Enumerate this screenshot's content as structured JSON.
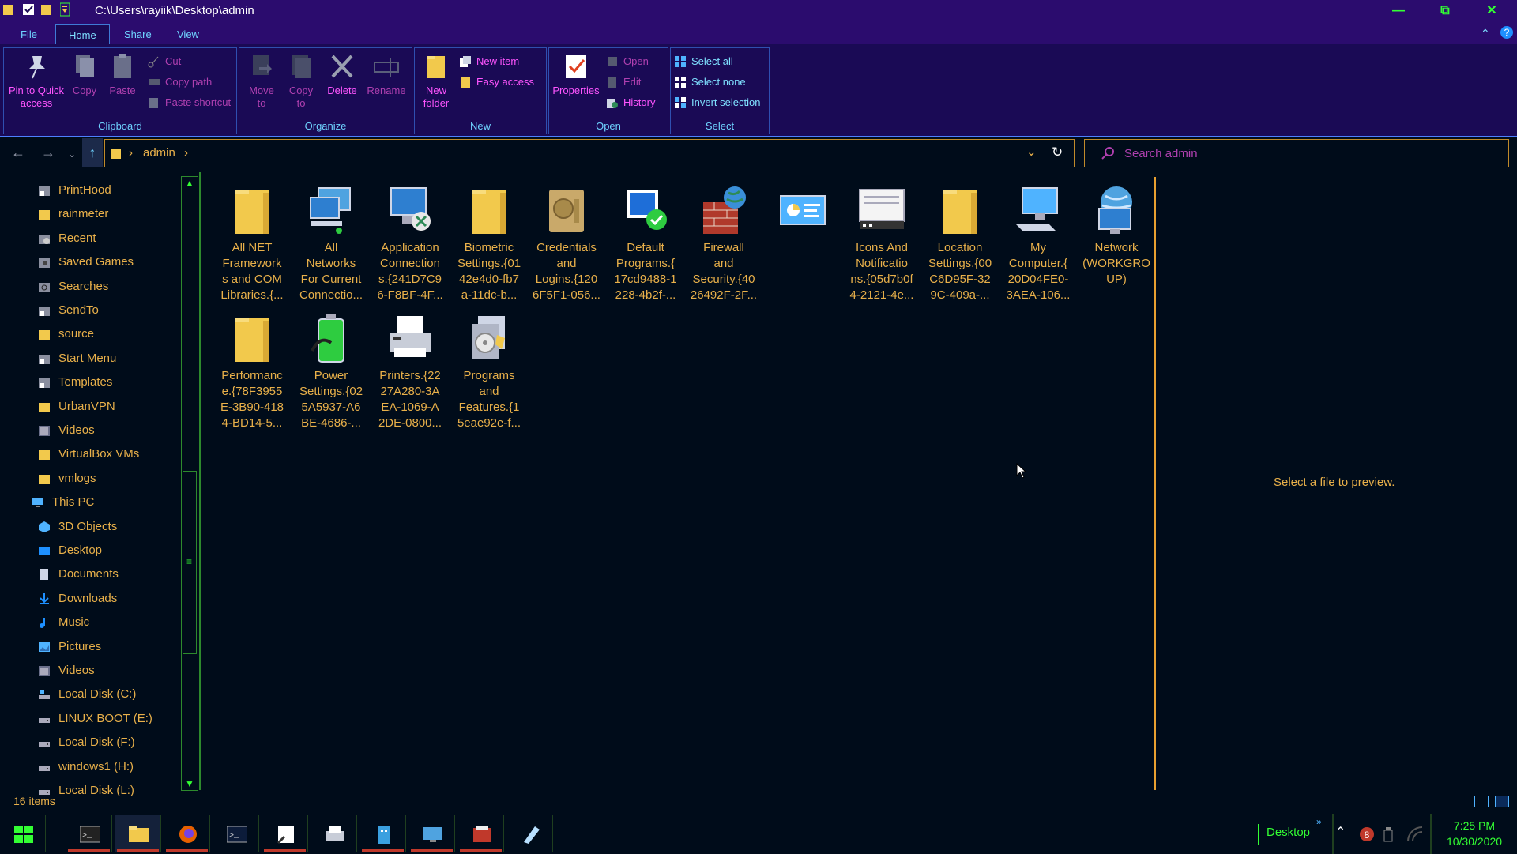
{
  "window": {
    "title": "C:\\Users\\rayiik\\Desktop\\admin",
    "minimize_glyph": "—",
    "maximize_glyph": "⧉",
    "close_glyph": "✕"
  },
  "ribbon_tabs": [
    "File",
    "Home",
    "Share",
    "View"
  ],
  "ribbon": {
    "clipboard": {
      "label": "Clipboard",
      "pin": "Pin to Quick access",
      "copy": "Copy",
      "paste": "Paste",
      "cut": "Cut",
      "copy_path": "Copy path",
      "paste_shortcut": "Paste shortcut"
    },
    "organize": {
      "label": "Organize",
      "move_to": "Move to",
      "copy_to": "Copy to",
      "delete": "Delete",
      "rename": "Rename"
    },
    "new": {
      "label": "New",
      "new_folder": "New folder",
      "new_item": "New item",
      "easy_access": "Easy access"
    },
    "open": {
      "label": "Open",
      "properties": "Properties",
      "open": "Open",
      "edit": "Edit",
      "history": "History"
    },
    "select": {
      "label": "Select",
      "select_all": "Select all",
      "select_none": "Select none",
      "invert_selection": "Invert selection"
    }
  },
  "address": {
    "crumbs": [
      "admin"
    ],
    "search_placeholder": "Search admin"
  },
  "nav_items": [
    {
      "label": "PrintHood",
      "icon": "shortcut-folder-icon"
    },
    {
      "label": "rainmeter",
      "icon": "folder-icon"
    },
    {
      "label": "Recent",
      "icon": "recent-icon"
    },
    {
      "label": "Saved Games",
      "icon": "saved-games-icon"
    },
    {
      "label": "Searches",
      "icon": "searches-icon"
    },
    {
      "label": "SendTo",
      "icon": "shortcut-folder-icon"
    },
    {
      "label": "source",
      "icon": "folder-icon"
    },
    {
      "label": "Start Menu",
      "icon": "shortcut-folder-icon"
    },
    {
      "label": "Templates",
      "icon": "shortcut-folder-icon"
    },
    {
      "label": "UrbanVPN",
      "icon": "folder-icon"
    },
    {
      "label": "Videos",
      "icon": "videos-icon"
    },
    {
      "label": "VirtualBox VMs",
      "icon": "folder-icon"
    },
    {
      "label": "vmlogs",
      "icon": "folder-icon"
    },
    {
      "label": "This PC",
      "icon": "this-pc-icon"
    },
    {
      "label": "3D Objects",
      "icon": "3d-objects-icon"
    },
    {
      "label": "Desktop",
      "icon": "desktop-icon"
    },
    {
      "label": "Documents",
      "icon": "documents-icon"
    },
    {
      "label": "Downloads",
      "icon": "downloads-icon"
    },
    {
      "label": "Music",
      "icon": "music-icon"
    },
    {
      "label": "Pictures",
      "icon": "pictures-icon"
    },
    {
      "label": "Videos",
      "icon": "videos-icon"
    },
    {
      "label": "Local Disk (C:)",
      "icon": "system-drive-icon"
    },
    {
      "label": "LINUX BOOT (E:)",
      "icon": "drive-icon"
    },
    {
      "label": "Local Disk (F:)",
      "icon": "drive-icon"
    },
    {
      "label": "windows1 (H:)",
      "icon": "drive-icon"
    },
    {
      "label": "Local Disk (L:)",
      "icon": "drive-icon"
    }
  ],
  "files": [
    {
      "lines": [
        "All NET",
        "Framework",
        "s and COM",
        "Libraries.{..."
      ],
      "icon": "folder-icon"
    },
    {
      "lines": [
        "All",
        "Networks",
        "For Current",
        "Connectio..."
      ],
      "icon": "network-computers-icon"
    },
    {
      "lines": [
        "Application",
        "Connection",
        "s.{241D7C9",
        "6-F8BF-4F..."
      ],
      "icon": "remote-app-icon"
    },
    {
      "lines": [
        "Biometric",
        "Settings.{01",
        "42e4d0-fb7",
        "a-11dc-b..."
      ],
      "icon": "folder-icon"
    },
    {
      "lines": [
        "Credentials",
        "and",
        "Logins.{120",
        "6F5F1-056..."
      ],
      "icon": "credentials-vault-icon"
    },
    {
      "lines": [
        "Default",
        "Programs.{",
        "17cd9488-1",
        "228-4b2f-..."
      ],
      "icon": "default-programs-icon"
    },
    {
      "lines": [
        "Firewall",
        "and",
        "Security.{40",
        "26492F-2F..."
      ],
      "icon": "firewall-icon"
    },
    {
      "lines": [],
      "icon": "control-panel-icon"
    },
    {
      "lines": [
        "Icons And",
        "Notificatio",
        "ns.{05d7b0f",
        "4-2121-4e..."
      ],
      "icon": "notifications-icon"
    },
    {
      "lines": [
        "Location",
        "Settings.{00",
        "C6D95F-32",
        "9C-409a-..."
      ],
      "icon": "folder-icon"
    },
    {
      "lines": [
        "My",
        "Computer.{",
        "20D04FE0-",
        "3AEA-106..."
      ],
      "icon": "computer-icon"
    },
    {
      "lines": [
        "Network",
        "(WORKGRO",
        "UP)"
      ],
      "icon": "network-globe-icon"
    },
    {
      "lines": [
        "Performanc",
        "e.{78F3955",
        "E-3B90-418",
        "4-BD14-5..."
      ],
      "icon": "folder-icon"
    },
    {
      "lines": [
        "Power",
        "Settings.{02",
        "5A5937-A6",
        "BE-4686-..."
      ],
      "icon": "power-battery-icon"
    },
    {
      "lines": [
        "Printers.{22",
        "27A280-3A",
        "EA-1069-A",
        "2DE-0800..."
      ],
      "icon": "printer-icon"
    },
    {
      "lines": [
        "Programs",
        "and",
        "Features.{1",
        "5eae92e-f..."
      ],
      "icon": "programs-features-icon"
    }
  ],
  "preview_text": "Select a file to preview.",
  "status": {
    "count": "16 items"
  },
  "taskbar": {
    "apps": [
      "start-icon",
      "terminal-icon",
      "file-explorer-icon",
      "firefox-icon",
      "powershell-icon",
      "notepad-icon",
      "printer-app-icon",
      "building-app-icon",
      "remote-desktop-icon",
      "media-app-icon",
      "pen-app-icon"
    ],
    "desktop_label": "Desktop",
    "time": "7:25 PM",
    "date": "10/30/2020"
  },
  "colors": {
    "background": "#000c1a",
    "titlebar": "#2b0c6e",
    "ribbon": "#1a0a55",
    "text_orange": "#e8b04a",
    "magenta": "#ff55ff",
    "cyan": "#6fd3ff",
    "green": "#33ff33"
  }
}
